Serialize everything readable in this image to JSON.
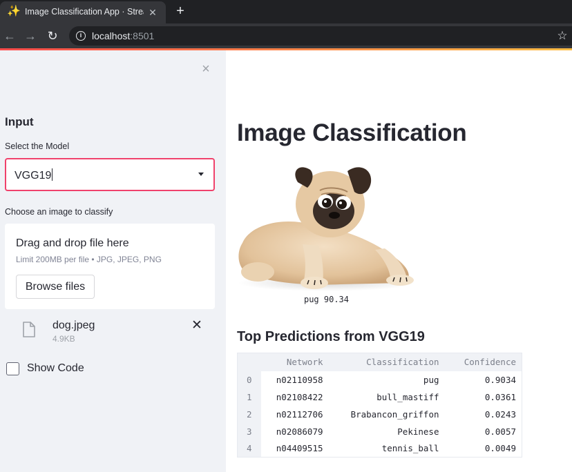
{
  "browser": {
    "tab_title": "Image Classification App · Streamlit",
    "url_host": "localhost",
    "url_port": ":8501"
  },
  "sidebar": {
    "heading": "Input",
    "model_label": "Select the Model",
    "model_value": "VGG19",
    "upload_label": "Choose an image to classify",
    "drop_title": "Drag and drop file here",
    "drop_hint": "Limit 200MB per file • JPG, JPEG, PNG",
    "browse_button": "Browse files",
    "file": {
      "name": "dog.jpeg",
      "size": "4.9KB"
    },
    "show_code_label": "Show Code",
    "show_code_checked": false
  },
  "main": {
    "title": "Image Classification",
    "image_caption": "pug 90.34",
    "predictions_heading": "Top Predictions from VGG19",
    "table": {
      "columns": [
        "Network",
        "Classification",
        "Confidence"
      ],
      "rows": [
        {
          "index": "0",
          "network": "n02110958",
          "classification": "pug",
          "confidence": "0.9034"
        },
        {
          "index": "1",
          "network": "n02108422",
          "classification": "bull_mastiff",
          "confidence": "0.0361"
        },
        {
          "index": "2",
          "network": "n02112706",
          "classification": "Brabancon_griffon",
          "confidence": "0.0243"
        },
        {
          "index": "3",
          "network": "n02086079",
          "classification": "Pekinese",
          "confidence": "0.0057"
        },
        {
          "index": "4",
          "network": "n04409515",
          "classification": "tennis_ball",
          "confidence": "0.0049"
        }
      ]
    }
  },
  "colors": {
    "accent": "#f0416b",
    "sidebar_bg": "#f0f2f6",
    "text": "#262730"
  },
  "icons": {
    "favicon": "sparkle-icon",
    "file": "file-icon"
  }
}
